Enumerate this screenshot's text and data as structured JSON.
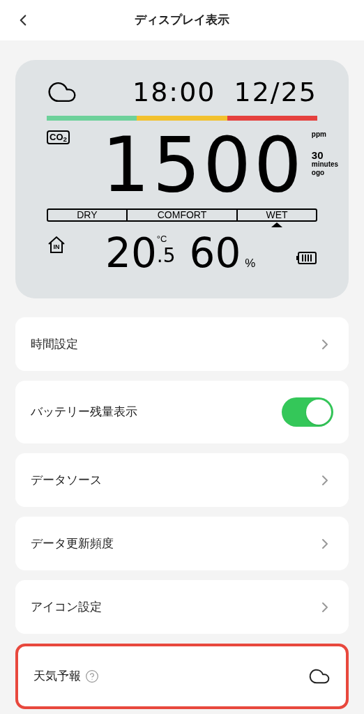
{
  "header": {
    "title": "ディスプレイ表示"
  },
  "display": {
    "time": "18:00",
    "date": "12/25",
    "bar": [
      {
        "color": "#6dd19a"
      },
      {
        "color": "#f2c12e"
      },
      {
        "color": "#e5413f"
      }
    ],
    "co2_label": "CO$_{2}$",
    "co2_value": "1500",
    "unit": "ppm",
    "ago_value": "30",
    "ago_line1": "minutes",
    "ago_line2": "ogo",
    "scale": [
      {
        "label": "DRY",
        "selected": false
      },
      {
        "label": "COMFORT",
        "selected": false
      },
      {
        "label": "WET",
        "selected": true
      }
    ],
    "indoor_label": "IN",
    "temp": "20",
    "temp_decimal": ".5",
    "temp_unit": "°C",
    "humidity": "60",
    "humidity_unit": "%"
  },
  "settings": [
    {
      "kind": "link",
      "label": "時間設定",
      "highlighted": false
    },
    {
      "kind": "toggle",
      "label": "バッテリー残量表示",
      "on": true,
      "highlighted": false
    },
    {
      "kind": "link",
      "label": "データソース",
      "highlighted": false
    },
    {
      "kind": "link",
      "label": "データ更新頻度",
      "highlighted": false
    },
    {
      "kind": "link",
      "label": "アイコン設定",
      "highlighted": false
    },
    {
      "kind": "weather",
      "label": "天気予報",
      "help": true,
      "highlighted": true
    }
  ]
}
